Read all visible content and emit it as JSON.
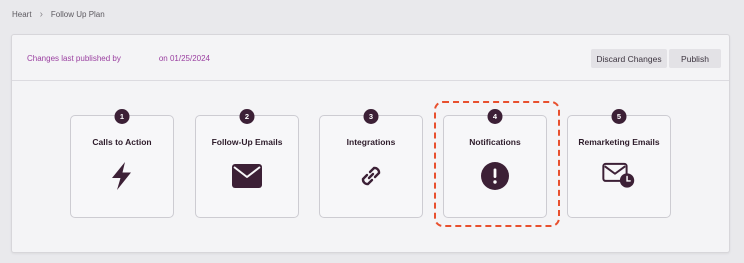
{
  "breadcrumb": {
    "items": [
      "Heart",
      "Follow Up Plan"
    ],
    "separator": "›"
  },
  "header": {
    "published_by": "Changes last published by",
    "published_on": "on 01/25/2024",
    "discard_label": "Discard Changes",
    "publish_label": "Publish"
  },
  "cards": [
    {
      "number": "1",
      "title": "Calls to Action",
      "icon": "lightning-icon"
    },
    {
      "number": "2",
      "title": "Follow-Up Emails",
      "icon": "envelope-icon"
    },
    {
      "number": "3",
      "title": "Integrations",
      "icon": "link-icon"
    },
    {
      "number": "4",
      "title": "Notifications",
      "icon": "exclamation-circle-icon",
      "highlighted": true
    },
    {
      "number": "5",
      "title": "Remarketing Emails",
      "icon": "envelope-clock-icon"
    }
  ],
  "colors": {
    "accent_dark": "#3c2036",
    "link_purple": "#9a3fa0",
    "highlight_dashed": "#e8502e"
  }
}
